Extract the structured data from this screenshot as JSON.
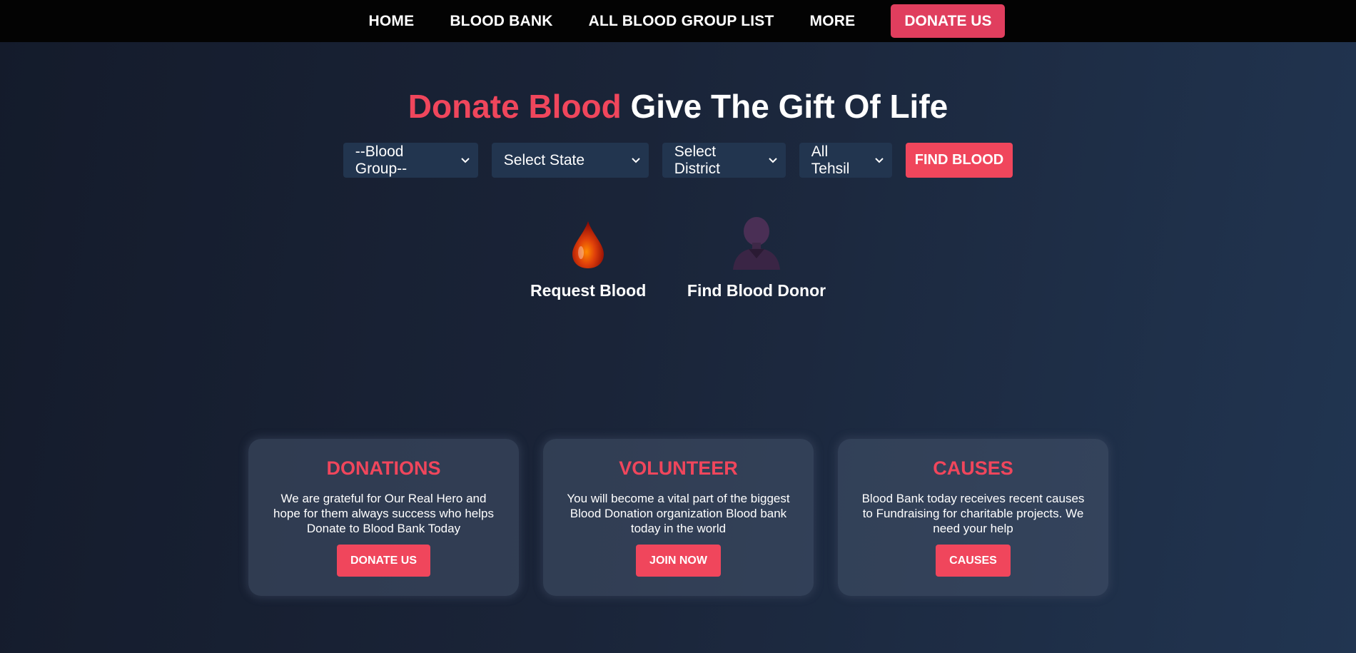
{
  "nav": {
    "items": [
      {
        "label": "HOME"
      },
      {
        "label": "BLOOD BANK"
      },
      {
        "label": "ALL BLOOD GROUP LIST"
      },
      {
        "label": "MORE"
      }
    ],
    "donate_label": "DONATE US"
  },
  "hero": {
    "title_accent": "Donate Blood",
    "title_rest": " Give The Gift Of Life"
  },
  "filters": {
    "blood_group": "--Blood Group--",
    "state": "Select State",
    "district": "Select District",
    "tehsil": "All Tehsil",
    "find_label": "FIND BLOOD"
  },
  "features": [
    {
      "label": "Request Blood",
      "icon": "blood-drop-icon"
    },
    {
      "label": "Find Blood Donor",
      "icon": "donor-person-icon"
    }
  ],
  "cards": [
    {
      "title": "DONATIONS",
      "text": "We are grateful for Our Real Hero and hope for them always success who helps Donate to Blood Bank Today",
      "button": "DONATE US"
    },
    {
      "title": "VOLUNTEER",
      "text": "You will become a vital part of the biggest Blood Donation organization Blood bank today in the world",
      "button": "JOIN NOW"
    },
    {
      "title": "CAUSES",
      "text": "Blood Bank today receives recent causes to Fundraising for charitable projects. We need your help",
      "button": "CAUSES"
    }
  ],
  "colors": {
    "accent": "#f0465c",
    "nav_donate": "#e03e5e",
    "nav_bg": "#030303",
    "select_bg": "#22354f"
  }
}
